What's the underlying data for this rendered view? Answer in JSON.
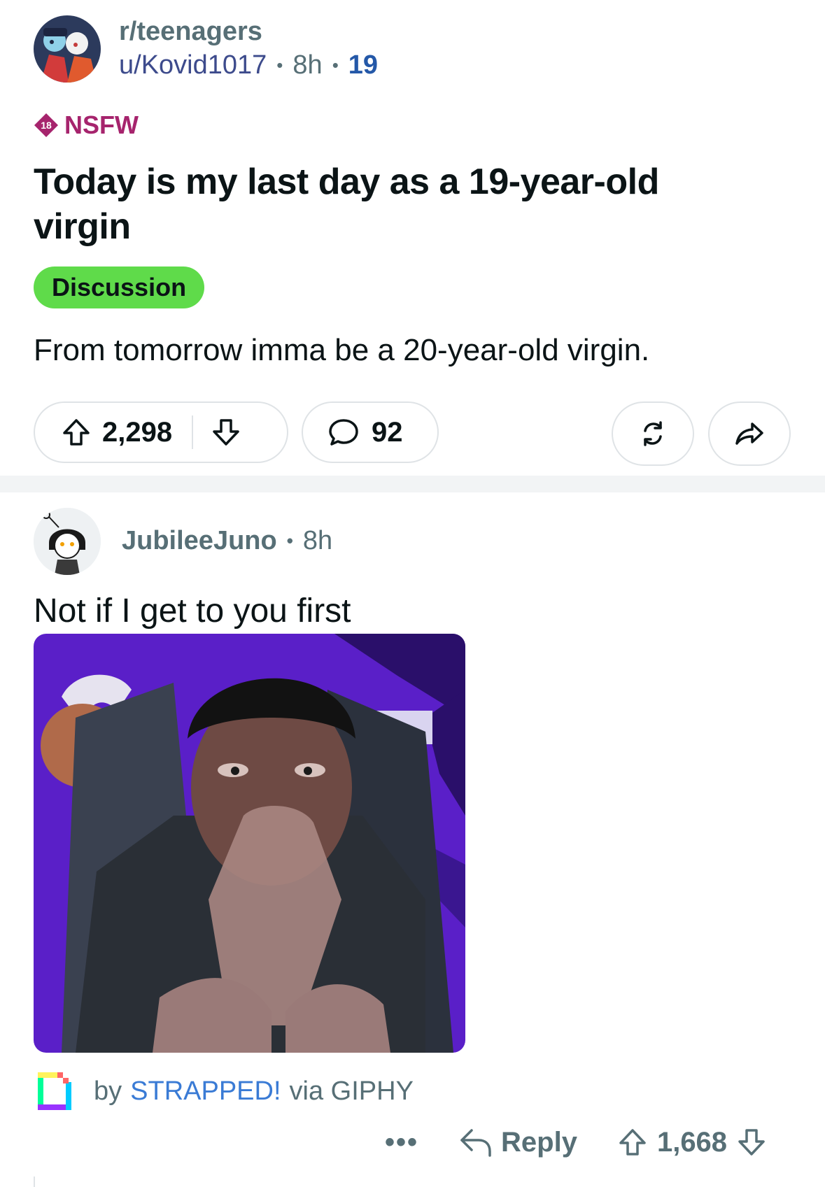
{
  "post": {
    "subreddit": "r/teenagers",
    "author": "u/Kovid1017",
    "age": "8h",
    "meta_count": "19",
    "nsfw_badge": "18",
    "nsfw_label": "NSFW",
    "title": "Today is my last day as a 19-year-old virgin",
    "flair": "Discussion",
    "body": "From tomorrow imma be a 20-year-old virgin.",
    "score": "2,298",
    "comments": "92",
    "colors": {
      "nsfw": "#a6246d",
      "flair": "#5fdb4a",
      "divider": "#f2f4f5"
    }
  },
  "comment": {
    "author": "JubileeJuno",
    "age": "8h",
    "text": "Not if I get to you first",
    "gif_credit_prefix": "by",
    "gif_artist": "STRAPPED!",
    "gif_credit_suffix": "via GIPHY",
    "more_label": "•••",
    "reply_label": "Reply",
    "score": "1,668"
  },
  "icons": {
    "upvote": "arrow-up-icon",
    "downvote": "arrow-down-icon",
    "comment": "speech-bubble-icon",
    "award": "repost-icon",
    "share": "share-arrow-icon",
    "reply": "reply-arrow-icon",
    "giphy": "giphy-logo-icon"
  }
}
